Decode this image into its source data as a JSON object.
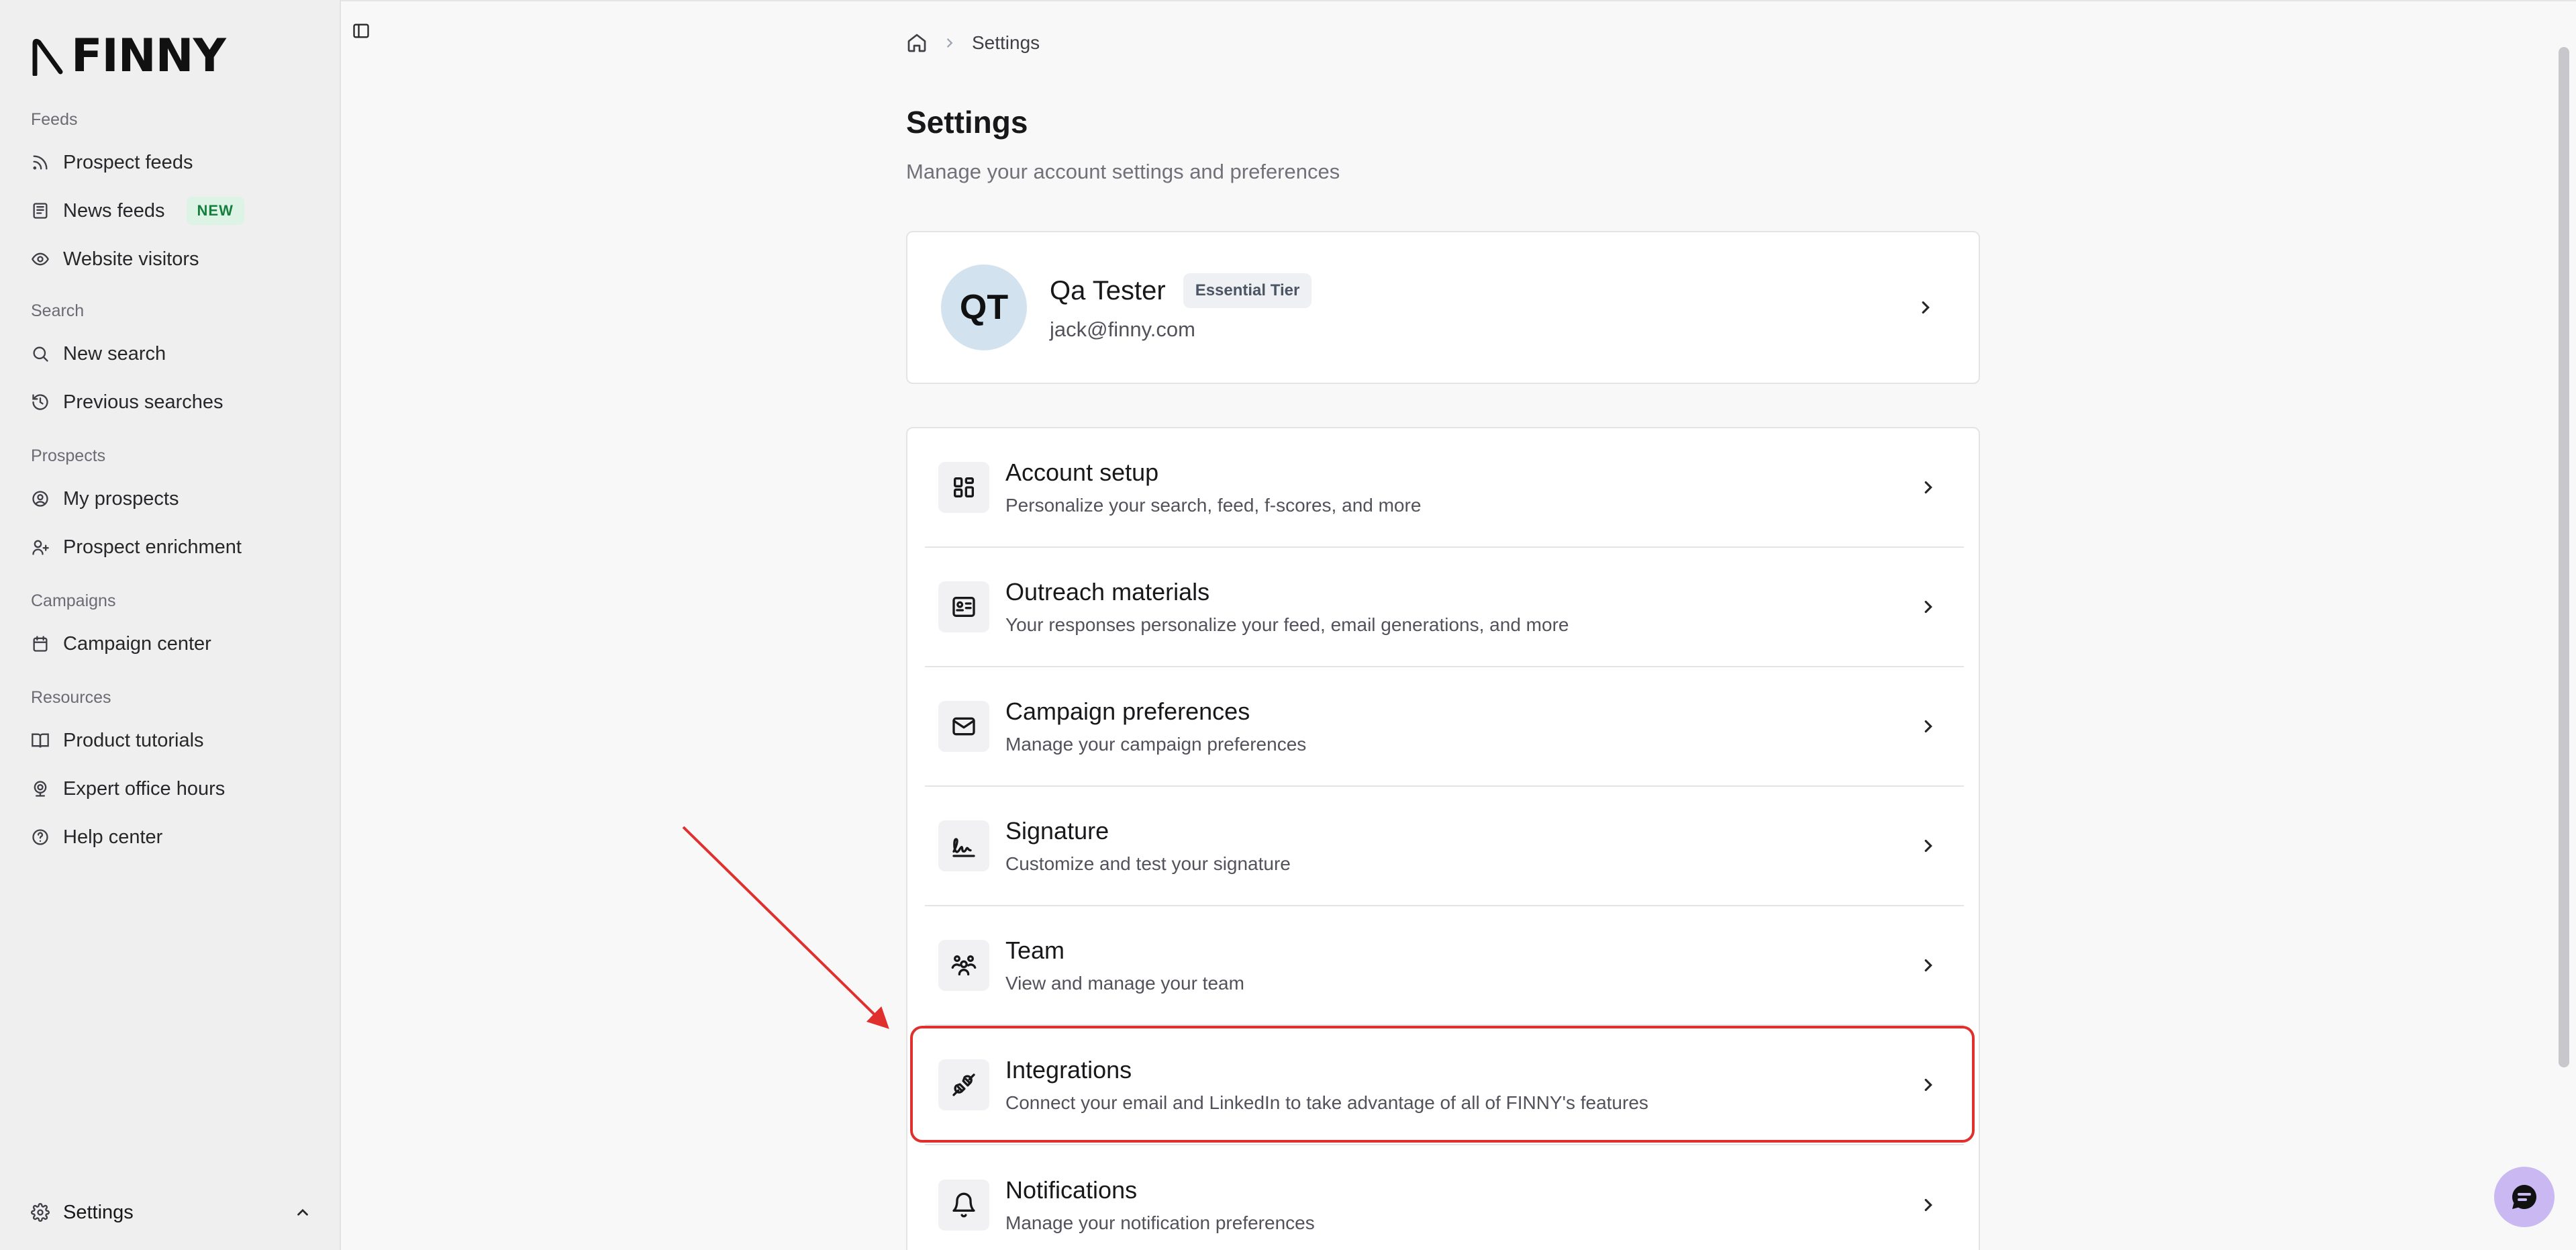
{
  "app": {
    "logo_text": "FINNY"
  },
  "sidebar": {
    "groups": [
      {
        "label": "Feeds",
        "items": [
          {
            "label": "Prospect feeds",
            "icon": "rss-icon"
          },
          {
            "label": "News feeds",
            "icon": "newspaper-icon",
            "badge": "NEW"
          },
          {
            "label": "Website visitors",
            "icon": "eye-icon"
          }
        ]
      },
      {
        "label": "Search",
        "items": [
          {
            "label": "New search",
            "icon": "search-icon"
          },
          {
            "label": "Previous searches",
            "icon": "history-icon"
          }
        ]
      },
      {
        "label": "Prospects",
        "items": [
          {
            "label": "My prospects",
            "icon": "user-circle-icon"
          },
          {
            "label": "Prospect enrichment",
            "icon": "user-plus-icon"
          }
        ]
      },
      {
        "label": "Campaigns",
        "items": [
          {
            "label": "Campaign center",
            "icon": "calendar-icon"
          }
        ]
      },
      {
        "label": "Resources",
        "items": [
          {
            "label": "Product tutorials",
            "icon": "book-icon"
          },
          {
            "label": "Expert office hours",
            "icon": "webcam-icon"
          },
          {
            "label": "Help center",
            "icon": "help-circle-icon"
          }
        ]
      }
    ],
    "footer": {
      "label": "Settings",
      "icon": "gear-icon"
    }
  },
  "breadcrumb": {
    "current": "Settings"
  },
  "page": {
    "title": "Settings",
    "subtitle": "Manage your account settings and preferences"
  },
  "profile": {
    "initials": "QT",
    "name": "Qa Tester",
    "tier": "Essential Tier",
    "email": "jack@finny.com"
  },
  "settings_rows": [
    {
      "title": "Account setup",
      "desc": "Personalize your search, feed, f-scores, and more",
      "icon": "layout-grid-icon"
    },
    {
      "title": "Outreach materials",
      "desc": "Your responses personalize your feed, email generations, and more",
      "icon": "id-card-icon"
    },
    {
      "title": "Campaign preferences",
      "desc": "Manage your campaign preferences",
      "icon": "mail-icon"
    },
    {
      "title": "Signature",
      "desc": "Customize and test your signature",
      "icon": "signature-icon"
    },
    {
      "title": "Team",
      "desc": "View and manage your team",
      "icon": "users-icon"
    },
    {
      "title": "Integrations",
      "desc": "Connect your email and LinkedIn to take advantage of all of FINNY's features",
      "icon": "plug-icon",
      "highlighted": true
    },
    {
      "title": "Notifications",
      "desc": "Manage your notification preferences",
      "icon": "bell-icon"
    }
  ],
  "colors": {
    "highlight": "#e0302e",
    "badge_new_bg": "#dcf3e6",
    "badge_new_text": "#15803d"
  }
}
